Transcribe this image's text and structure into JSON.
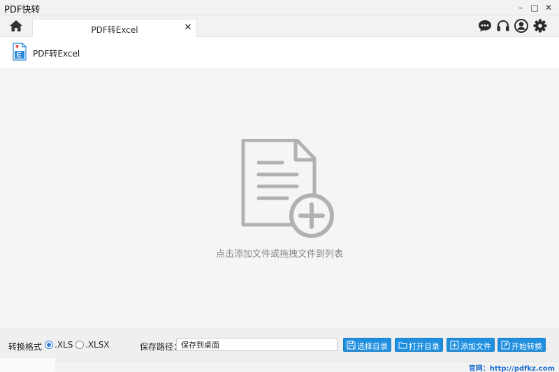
{
  "window": {
    "title": "PDF快转",
    "minimize": "–",
    "maximize": "□",
    "close": "✕"
  },
  "tabs": [
    {
      "label": "PDF转Excel",
      "close": "✕"
    }
  ],
  "toolbar_icons": [
    "chat-icon",
    "headset-icon",
    "user-icon",
    "gear-icon"
  ],
  "header": {
    "title": "PDF转Excel"
  },
  "dropzone": {
    "hint": "点击添加文件或拖拽文件到列表"
  },
  "bottom": {
    "format_label": "转换格式",
    "formats": [
      {
        "label": ".XLS",
        "selected": true
      },
      {
        "label": ".XLSX",
        "selected": false
      }
    ],
    "path_label": "保存路径：",
    "path_value": "保存到桌面",
    "buttons": [
      {
        "label": "选择目录",
        "icon": "save-icon"
      },
      {
        "label": "打开目录",
        "icon": "folder-icon"
      },
      {
        "label": "添加文件",
        "icon": "plus-icon"
      },
      {
        "label": "开始转换",
        "icon": "convert-icon"
      }
    ]
  },
  "footer": {
    "site": "官网：http://pdfkz.com"
  },
  "colors": {
    "accent": "#1f8fe0",
    "link": "#1f6fd0",
    "dropzone_bg": "#f5f5f5",
    "icon_gray": "#b1b1b1"
  }
}
